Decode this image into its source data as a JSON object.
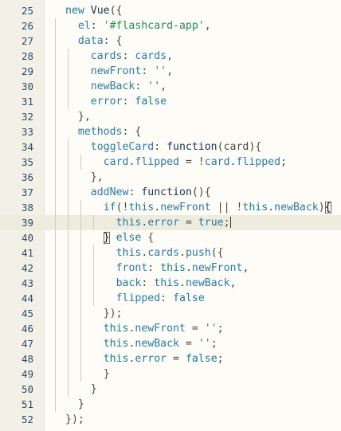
{
  "editor": {
    "active_line": 39,
    "lines": [
      {
        "n": "25",
        "indent": 0,
        "tokens": [
          [
            "kw",
            "new "
          ],
          [
            "fn",
            "Vue"
          ],
          [
            "p",
            "({"
          ]
        ]
      },
      {
        "n": "26",
        "indent": 1,
        "tokens": [
          [
            "prop",
            "el"
          ],
          [
            "p",
            ": "
          ],
          [
            "str",
            "'#flashcard-app'"
          ],
          [
            "p",
            ","
          ]
        ]
      },
      {
        "n": "27",
        "indent": 1,
        "tokens": [
          [
            "prop",
            "data"
          ],
          [
            "p",
            ": {"
          ]
        ]
      },
      {
        "n": "28",
        "indent": 2,
        "tokens": [
          [
            "prop",
            "cards"
          ],
          [
            "p",
            ": "
          ],
          [
            "prop",
            "cards"
          ],
          [
            "p",
            ","
          ]
        ]
      },
      {
        "n": "29",
        "indent": 2,
        "tokens": [
          [
            "prop",
            "newFront"
          ],
          [
            "p",
            ": "
          ],
          [
            "str",
            "''"
          ],
          [
            "p",
            ","
          ]
        ]
      },
      {
        "n": "30",
        "indent": 2,
        "tokens": [
          [
            "prop",
            "newBack"
          ],
          [
            "p",
            ": "
          ],
          [
            "str",
            "''"
          ],
          [
            "p",
            ","
          ]
        ]
      },
      {
        "n": "31",
        "indent": 2,
        "tokens": [
          [
            "prop",
            "error"
          ],
          [
            "p",
            ": "
          ],
          [
            "bool",
            "false"
          ]
        ]
      },
      {
        "n": "32",
        "indent": 1,
        "tokens": [
          [
            "p",
            "},"
          ]
        ]
      },
      {
        "n": "33",
        "indent": 1,
        "tokens": [
          [
            "prop",
            "methods"
          ],
          [
            "p",
            ": {"
          ]
        ]
      },
      {
        "n": "34",
        "indent": 2,
        "tokens": [
          [
            "prop",
            "toggleCard"
          ],
          [
            "p",
            ": "
          ],
          [
            "fn",
            "function"
          ],
          [
            "p",
            "(card){"
          ]
        ]
      },
      {
        "n": "35",
        "indent": 3,
        "tokens": [
          [
            "prop",
            "card"
          ],
          [
            "p",
            "."
          ],
          [
            "prop",
            "flipped"
          ],
          [
            "p",
            " = !"
          ],
          [
            "prop",
            "card"
          ],
          [
            "p",
            "."
          ],
          [
            "prop",
            "flipped"
          ],
          [
            "p",
            ";"
          ]
        ]
      },
      {
        "n": "36",
        "indent": 2,
        "tokens": [
          [
            "p",
            "},"
          ]
        ]
      },
      {
        "n": "37",
        "indent": 2,
        "tokens": [
          [
            "prop",
            "addNew"
          ],
          [
            "p",
            ": "
          ],
          [
            "fn",
            "function"
          ],
          [
            "p",
            "(){"
          ]
        ]
      },
      {
        "n": "38",
        "indent": 3,
        "tokens": [
          [
            "kw",
            "if"
          ],
          [
            "p",
            "(!"
          ],
          [
            "kw",
            "this"
          ],
          [
            "p",
            "."
          ],
          [
            "prop",
            "newFront"
          ],
          [
            "p",
            " || !"
          ],
          [
            "kw",
            "this"
          ],
          [
            "p",
            "."
          ],
          [
            "prop",
            "newBack"
          ],
          [
            "p",
            ")"
          ],
          [
            "bm",
            "{"
          ]
        ]
      },
      {
        "n": "39",
        "indent": 4,
        "tokens": [
          [
            "kw",
            "this"
          ],
          [
            "p",
            "."
          ],
          [
            "prop",
            "error"
          ],
          [
            "p",
            " = "
          ],
          [
            "bool",
            "true"
          ],
          [
            "p",
            ";"
          ]
        ]
      },
      {
        "n": "40",
        "indent": 3,
        "tokens": [
          [
            "bm",
            "}"
          ],
          [
            "p",
            " "
          ],
          [
            "kw",
            "else"
          ],
          [
            "p",
            " {"
          ]
        ]
      },
      {
        "n": "41",
        "indent": 4,
        "tokens": [
          [
            "kw",
            "this"
          ],
          [
            "p",
            "."
          ],
          [
            "prop",
            "cards"
          ],
          [
            "p",
            "."
          ],
          [
            "prop",
            "push"
          ],
          [
            "p",
            "({"
          ]
        ]
      },
      {
        "n": "42",
        "indent": 4,
        "tokens": [
          [
            "prop",
            "front"
          ],
          [
            "p",
            ": "
          ],
          [
            "kw",
            "this"
          ],
          [
            "p",
            "."
          ],
          [
            "prop",
            "newFront"
          ],
          [
            "p",
            ","
          ]
        ]
      },
      {
        "n": "43",
        "indent": 4,
        "tokens": [
          [
            "prop",
            "back"
          ],
          [
            "p",
            ": "
          ],
          [
            "kw",
            "this"
          ],
          [
            "p",
            "."
          ],
          [
            "prop",
            "newBack"
          ],
          [
            "p",
            ","
          ]
        ]
      },
      {
        "n": "44",
        "indent": 4,
        "tokens": [
          [
            "prop",
            "flipped"
          ],
          [
            "p",
            ": "
          ],
          [
            "bool",
            "false"
          ]
        ]
      },
      {
        "n": "45",
        "indent": 3,
        "tokens": [
          [
            "p",
            "});"
          ]
        ]
      },
      {
        "n": "46",
        "indent": 3,
        "tokens": [
          [
            "kw",
            "this"
          ],
          [
            "p",
            "."
          ],
          [
            "prop",
            "newFront"
          ],
          [
            "p",
            " = "
          ],
          [
            "str",
            "''"
          ],
          [
            "p",
            ";"
          ]
        ]
      },
      {
        "n": "47",
        "indent": 3,
        "tokens": [
          [
            "kw",
            "this"
          ],
          [
            "p",
            "."
          ],
          [
            "prop",
            "newBack"
          ],
          [
            "p",
            " = "
          ],
          [
            "str",
            "''"
          ],
          [
            "p",
            ";"
          ]
        ]
      },
      {
        "n": "48",
        "indent": 3,
        "tokens": [
          [
            "kw",
            "this"
          ],
          [
            "p",
            "."
          ],
          [
            "prop",
            "error"
          ],
          [
            "p",
            " = "
          ],
          [
            "bool",
            "false"
          ],
          [
            "p",
            ";"
          ]
        ]
      },
      {
        "n": "49",
        "indent": 3,
        "tokens": [
          [
            "p",
            "}"
          ]
        ]
      },
      {
        "n": "50",
        "indent": 2,
        "tokens": [
          [
            "p",
            "}"
          ]
        ]
      },
      {
        "n": "51",
        "indent": 1,
        "tokens": [
          [
            "p",
            "}"
          ]
        ]
      },
      {
        "n": "52",
        "indent": 0,
        "tokens": [
          [
            "p",
            "});"
          ]
        ]
      }
    ]
  }
}
